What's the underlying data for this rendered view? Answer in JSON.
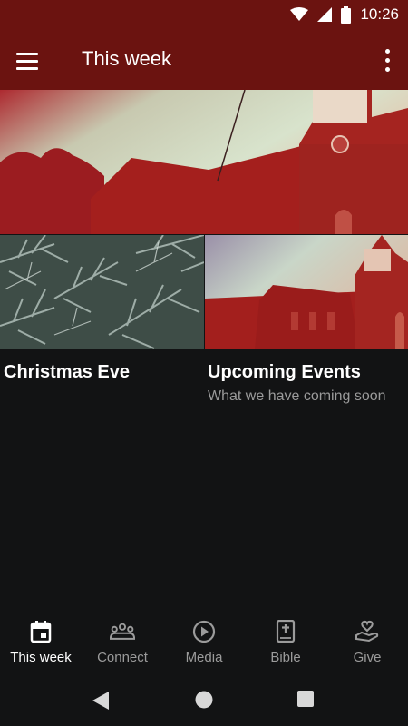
{
  "status": {
    "time": "10:26",
    "icons": [
      "wifi-icon",
      "cell-signal-icon",
      "battery-icon"
    ]
  },
  "app_bar": {
    "title": "This week",
    "menu_icon": "hamburger-menu-icon",
    "more_icon": "more-vertical-icon"
  },
  "hero": {
    "image": "church-exterior-photo"
  },
  "cards": [
    {
      "title": "Christmas Eve",
      "subtitle": "",
      "image": "pine-branches-photo"
    },
    {
      "title": "Upcoming Events",
      "subtitle": "What we have coming soon",
      "image": "church-steeple-photo"
    }
  ],
  "bottom_nav": [
    {
      "label": "This week",
      "icon": "calendar-icon",
      "active": true
    },
    {
      "label": "Connect",
      "icon": "people-group-icon",
      "active": false
    },
    {
      "label": "Media",
      "icon": "play-circle-icon",
      "active": false
    },
    {
      "label": "Bible",
      "icon": "bible-icon",
      "active": false
    },
    {
      "label": "Give",
      "icon": "heart-hand-icon",
      "active": false
    }
  ],
  "system_nav": [
    "back-icon",
    "home-icon",
    "recents-icon"
  ],
  "colors": {
    "primary": "#6b1310",
    "background": "#121314",
    "active_label": "#ffffff",
    "inactive_label": "#9b9b9b"
  }
}
